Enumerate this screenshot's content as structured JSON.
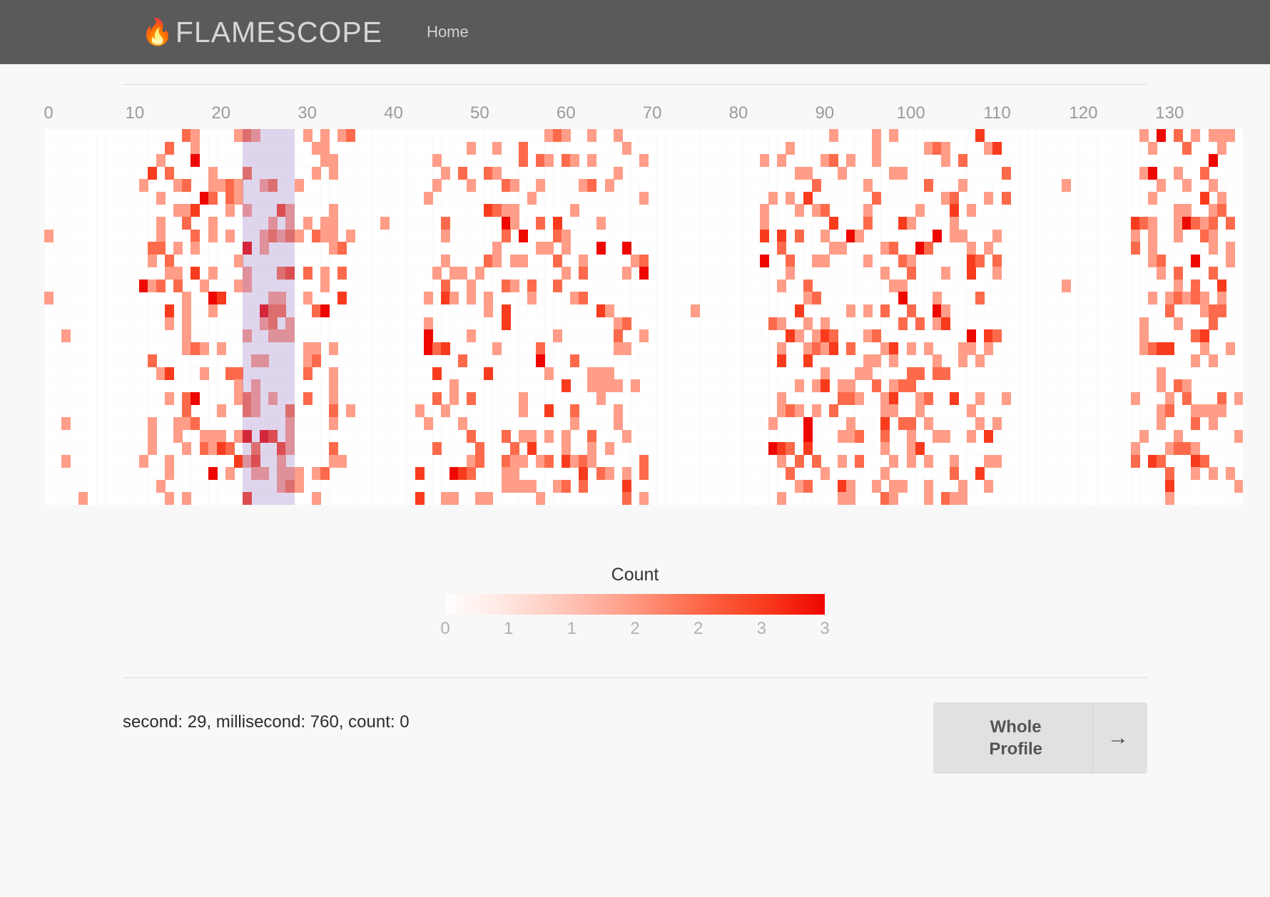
{
  "header": {
    "brand_icon": "flame-icon",
    "brand_glyph": "🔥",
    "brand_text": "FLAMESCOPE",
    "nav": [
      {
        "label": "Home"
      }
    ]
  },
  "chart_data": {
    "type": "heatmap",
    "title": "",
    "xlabel": "",
    "ylabel": "",
    "x_ticks": [
      "0",
      "10",
      "20",
      "30",
      "40",
      "50",
      "60",
      "70",
      "80",
      "90",
      "100",
      "110",
      "120",
      "130"
    ],
    "x_tick_values": [
      0,
      10,
      20,
      30,
      40,
      50,
      60,
      70,
      80,
      90,
      100,
      110,
      120,
      130
    ],
    "xlim": [
      0,
      139
    ],
    "rows": 30,
    "columns": 139,
    "row_label": "millisecond",
    "column_label": "second",
    "colorscale": [
      "#ffffff",
      "#ffe9e4",
      "#ffc9bd",
      "#ff9d88",
      "#fd6a4b",
      "#f93b1d",
      "#ee0701"
    ],
    "value_range": [
      0,
      3
    ],
    "active_bands": [
      {
        "start": 11,
        "end": 36,
        "density": 0.3
      },
      {
        "start": 43,
        "end": 70,
        "density": 0.27
      },
      {
        "start": 83,
        "end": 112,
        "density": 0.28
      },
      {
        "start": 126,
        "end": 139,
        "density": 0.33
      }
    ],
    "sparse_cells": [
      {
        "col": 0,
        "row": 8
      },
      {
        "col": 0,
        "row": 13
      },
      {
        "col": 2,
        "row": 16
      },
      {
        "col": 2,
        "row": 23
      },
      {
        "col": 2,
        "row": 26
      },
      {
        "col": 4,
        "row": 29
      },
      {
        "col": 39,
        "row": 7
      },
      {
        "col": 75,
        "row": 14
      },
      {
        "col": 118,
        "row": 4
      },
      {
        "col": 118,
        "row": 12
      },
      {
        "col": 105,
        "row": 30
      }
    ],
    "selection": {
      "start_second": 23,
      "end_second": 29,
      "color": "#9478c8"
    }
  },
  "legend": {
    "title": "Count",
    "ticks": [
      "0",
      "1",
      "1",
      "2",
      "2",
      "3",
      "3"
    ],
    "gradient_from": "#ffffff",
    "gradient_to": "#ee0701"
  },
  "footer": {
    "status": "second: 29, millisecond: 760, count: 0",
    "status_fields": {
      "second": 29,
      "millisecond": 760,
      "count": 0
    },
    "whole_profile_button": {
      "label": "Whole\nProfile",
      "arrow_glyph": "→"
    }
  }
}
